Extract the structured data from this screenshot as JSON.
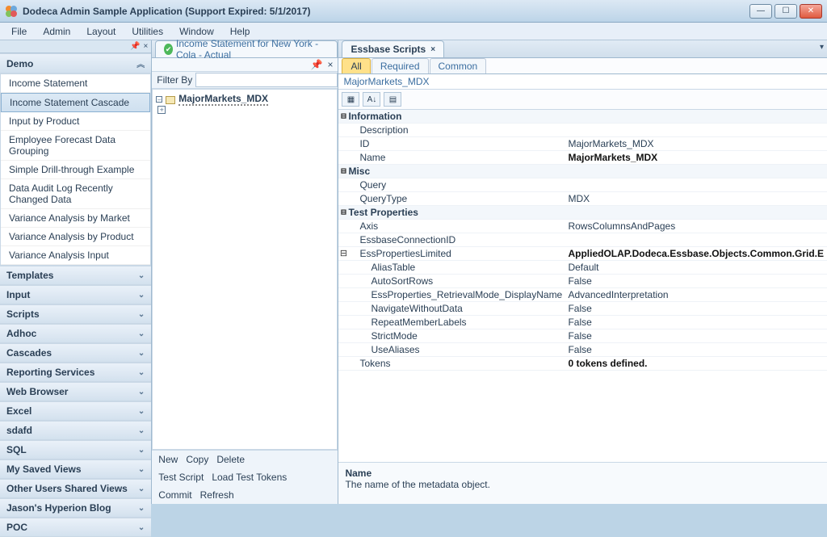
{
  "window": {
    "title": "Dodeca Admin Sample Application (Support Expired: 5/1/2017)"
  },
  "menu": {
    "file": "File",
    "admin": "Admin",
    "layout": "Layout",
    "utilities": "Utilities",
    "window": "Window",
    "help": "Help"
  },
  "leftnav": {
    "sections": [
      {
        "label": "Demo",
        "open": true
      },
      {
        "label": "Templates"
      },
      {
        "label": "Input"
      },
      {
        "label": "Scripts"
      },
      {
        "label": "Adhoc"
      },
      {
        "label": "Cascades"
      },
      {
        "label": "Reporting Services"
      },
      {
        "label": "Web Browser"
      },
      {
        "label": "Excel"
      },
      {
        "label": "sdafd"
      },
      {
        "label": "SQL"
      },
      {
        "label": "My Saved Views"
      },
      {
        "label": "Other Users Shared Views"
      },
      {
        "label": "Jason's Hyperion Blog"
      },
      {
        "label": "POC"
      }
    ],
    "demo_items": [
      "Income Statement",
      "Income Statement Cascade",
      "Input by Product",
      "Employee Forecast Data Grouping",
      "Simple Drill-through Example",
      "Data Audit Log Recently Changed Data",
      "Variance Analysis by Market",
      "Variance Analysis by Product",
      "Variance Analysis Input"
    ],
    "demo_selected_index": 1
  },
  "centerpanel": {
    "tab_label": "Income Statement for New York - Cola - Actual",
    "filter_label": "Filter By",
    "filter_value": "",
    "tree_node": "MajorMarkets_MDX",
    "buttons": {
      "new": "New",
      "copy": "Copy",
      "delete": "Delete",
      "test_script": "Test Script",
      "load_test_tokens": "Load Test Tokens",
      "commit": "Commit",
      "refresh": "Refresh"
    }
  },
  "rightpanel": {
    "tab_label": "Essbase Scripts",
    "subtabs": {
      "all": "All",
      "required": "Required",
      "common": "Common"
    },
    "object_label": "MajorMarkets_MDX",
    "categories": [
      {
        "name": "Information",
        "rows": [
          {
            "name": "Description",
            "value": ""
          },
          {
            "name": "ID",
            "value": "MajorMarkets_MDX"
          },
          {
            "name": "Name",
            "value": "MajorMarkets_MDX",
            "bold": true
          }
        ]
      },
      {
        "name": "Misc",
        "rows": [
          {
            "name": "Query",
            "value": ""
          },
          {
            "name": "QueryType",
            "value": "MDX"
          }
        ]
      },
      {
        "name": "Test Properties",
        "rows": [
          {
            "name": "Axis",
            "value": "RowsColumnsAndPages"
          },
          {
            "name": "EssbaseConnectionID",
            "value": ""
          },
          {
            "name": "EssPropertiesLimited",
            "value": "AppliedOLAP.Dodeca.Essbase.Objects.Common.Grid.E",
            "bold": true,
            "expandable": true,
            "children": [
              {
                "name": "AliasTable",
                "value": "Default"
              },
              {
                "name": "AutoSortRows",
                "value": "False"
              },
              {
                "name": "EssProperties_RetrievalMode_DisplayName",
                "value": "AdvancedInterpretation"
              },
              {
                "name": "NavigateWithoutData",
                "value": "False"
              },
              {
                "name": "RepeatMemberLabels",
                "value": "False"
              },
              {
                "name": "StrictMode",
                "value": "False"
              },
              {
                "name": "UseAliases",
                "value": "False"
              }
            ]
          },
          {
            "name": "Tokens",
            "value": "0 tokens defined.",
            "bold": true
          }
        ]
      }
    ],
    "description": {
      "title": "Name",
      "text": "The name of the metadata object."
    }
  }
}
